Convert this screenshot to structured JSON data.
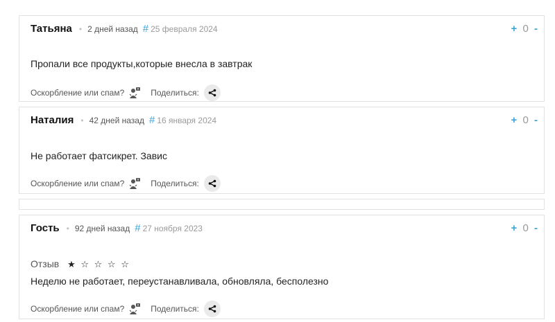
{
  "comments": [
    {
      "author": "Татьяна",
      "ago": "2 дней назад",
      "hash": "#",
      "date": "25 февраля 2024",
      "vote_plus": "+",
      "score": "0",
      "vote_minus": "-",
      "text": "Пропали все продукты,которые внесла в завтрак",
      "spam_label": "Оскорбление или спам?",
      "share_label": "Поделиться:"
    },
    {
      "author": "Наталия",
      "ago": "42 дней назад",
      "hash": "#",
      "date": "16 января 2024",
      "vote_plus": "+",
      "score": "0",
      "vote_minus": "-",
      "text": "Не работает фатсикрет. Завис",
      "spam_label": "Оскорбление или спам?",
      "share_label": "Поделиться:"
    },
    {
      "author": "Гость",
      "ago": "92 дней назад",
      "hash": "#",
      "date": "27 ноября 2023",
      "vote_plus": "+",
      "score": "0",
      "vote_minus": "-",
      "rating_label": "Отзыв",
      "rating_value": 1,
      "rating_max": 5,
      "stars": "★ ☆ ☆ ☆ ☆",
      "text": "Неделю не работает, переустанавливала, обновляла, бесполезно",
      "spam_label": "Оскорбление или спам?",
      "share_label": "Поделиться:"
    }
  ],
  "colors": {
    "accent": "#3aa3d8",
    "border": "#e2e2e2",
    "muted": "#9a9a9a"
  },
  "icons": {
    "spam": "spam-report-icon",
    "share": "share-icon"
  }
}
